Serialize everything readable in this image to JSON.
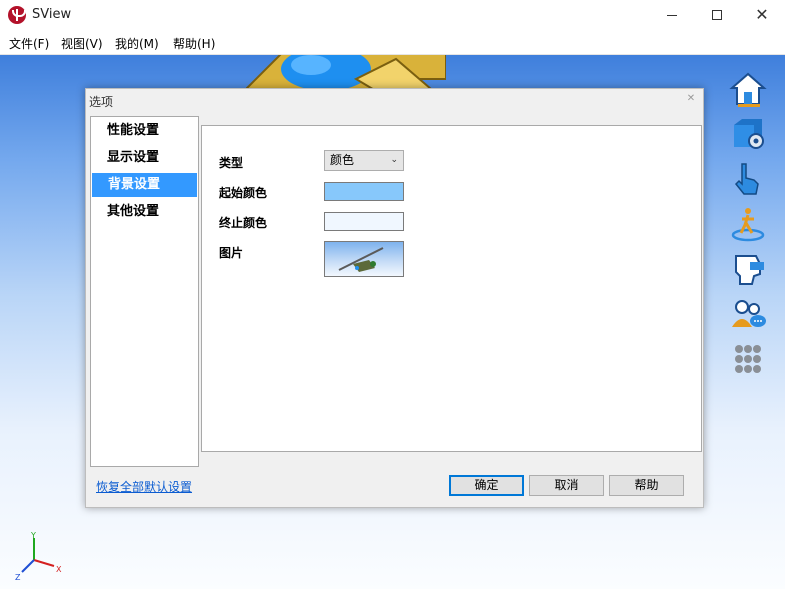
{
  "window": {
    "title": "SView",
    "buttons": {
      "minimize": "minimize",
      "maximize": "maximize",
      "close": "close"
    }
  },
  "menu": {
    "items": [
      "文件(F)",
      "视图(V)",
      "我的(M)",
      "帮助(H)"
    ]
  },
  "toolbar": {
    "icons": [
      "home-icon",
      "cube-settings-icon",
      "hand-pointer-icon",
      "walk-mode-icon",
      "head-view-icon",
      "users-chat-icon",
      "grid-apps-icon"
    ]
  },
  "axis": {
    "y": "Y",
    "x": "X",
    "z": "Z"
  },
  "dialog": {
    "title": "选项",
    "nav": [
      "性能设置",
      "显示设置",
      "背景设置",
      "其他设置"
    ],
    "selected_nav": "背景设置",
    "fields": {
      "type_label": "类型",
      "type_value": "颜色",
      "start_color_label": "起始颜色",
      "start_color": "#87c8fb",
      "end_color_label": "终止颜色",
      "end_color": "#f0f7ff",
      "image_label": "图片"
    },
    "restore_link": "恢复全部默认设置",
    "buttons": {
      "ok": "确定",
      "cancel": "取消",
      "help": "帮助"
    }
  },
  "colors": {
    "accent": "#3399ff",
    "link": "#0b5cd1"
  }
}
